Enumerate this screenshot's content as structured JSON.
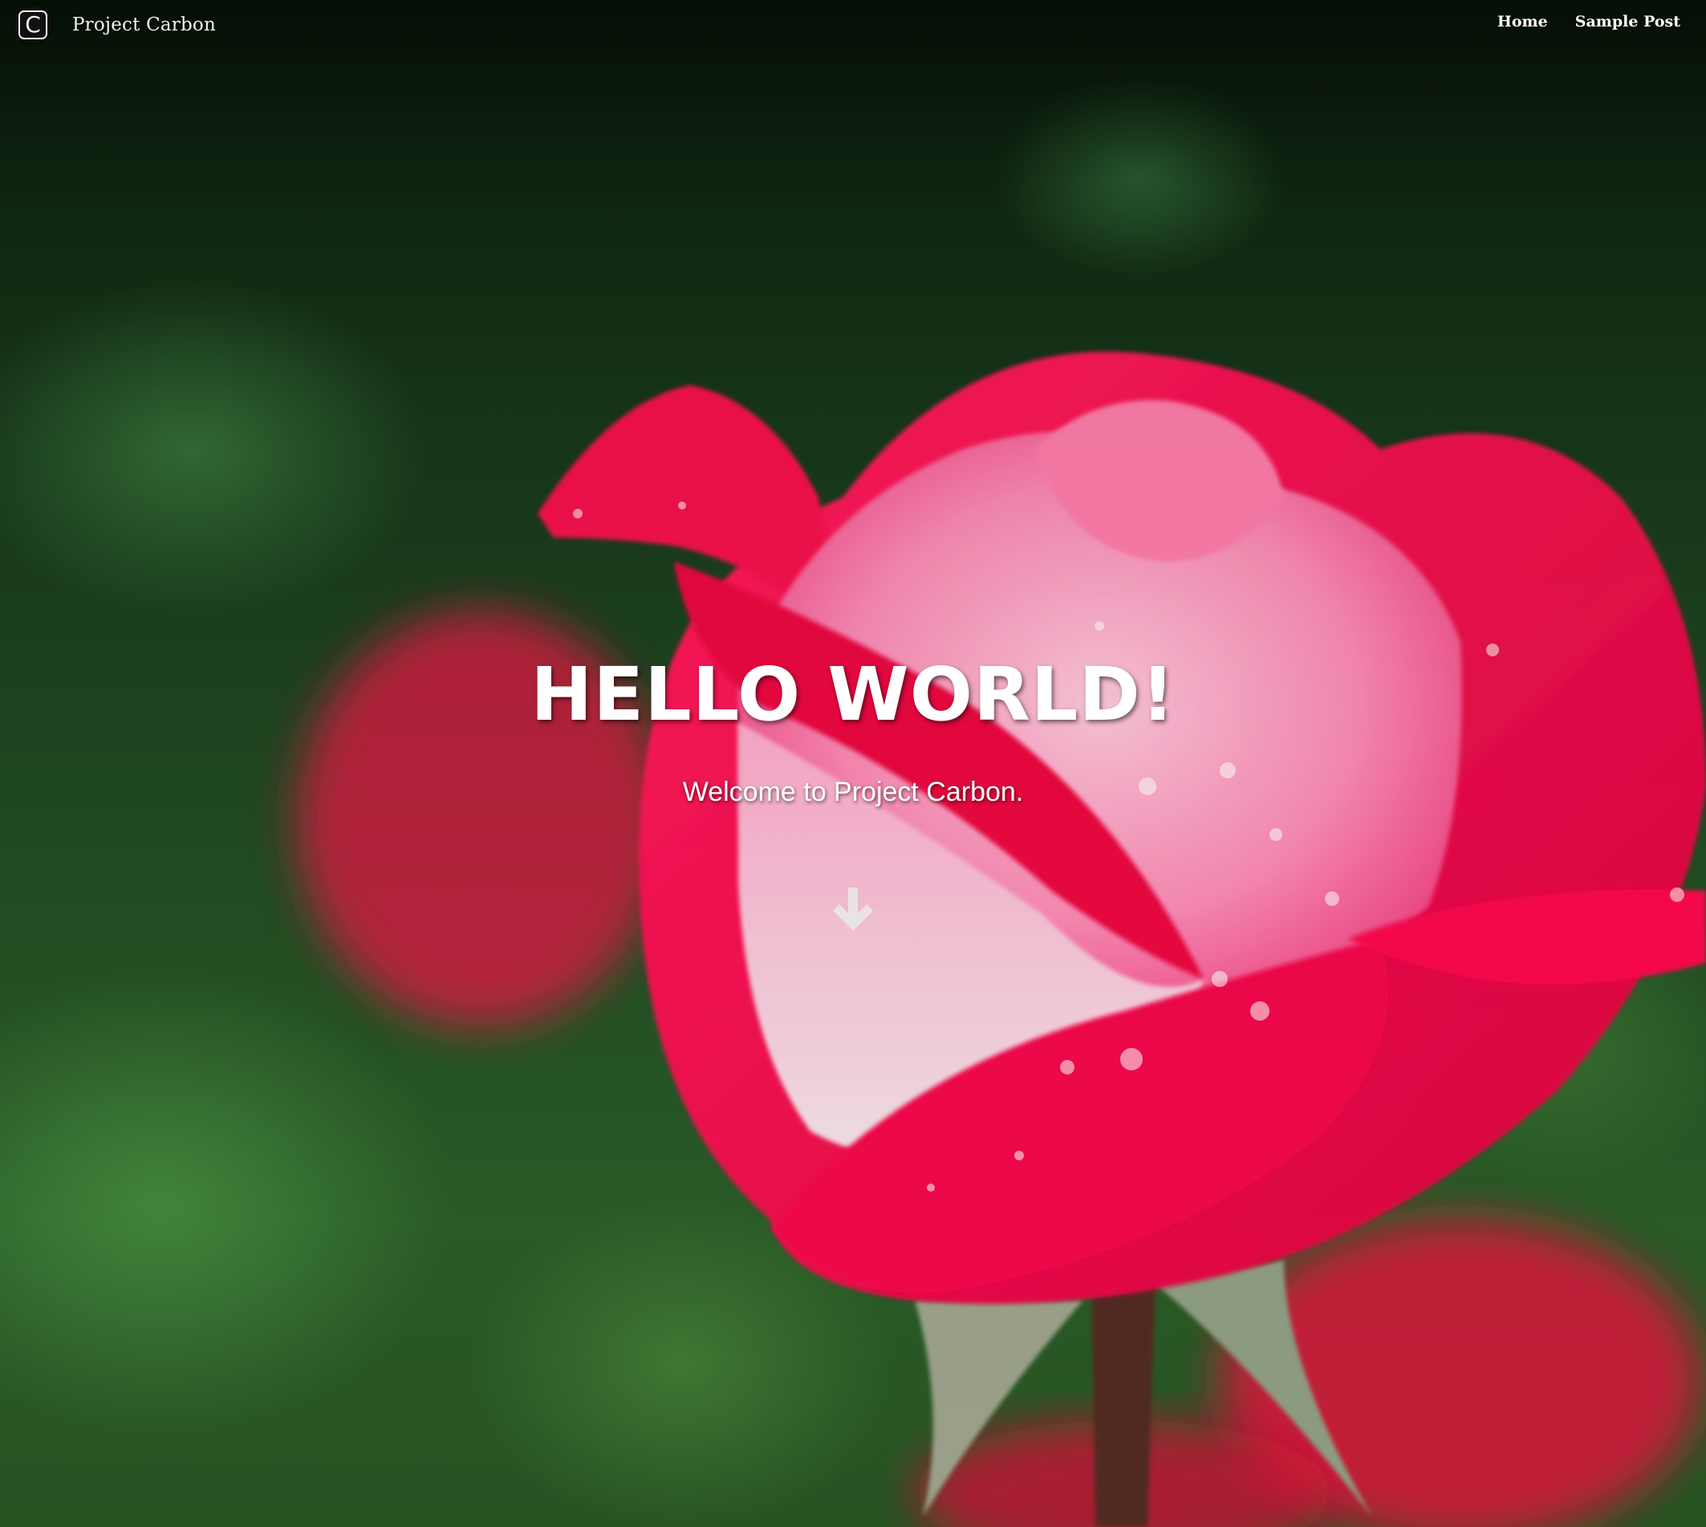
{
  "site": {
    "name": "Project Carbon",
    "logo_letter": "C"
  },
  "nav": {
    "items": [
      {
        "label": "Home"
      },
      {
        "label": "Sample Post"
      }
    ]
  },
  "hero": {
    "title": "HELLO WORLD!",
    "subtitle": "Welcome to Project Carbon.",
    "scroll_icon": "arrow-down-icon"
  },
  "colors": {
    "nav_text": "#ffffff",
    "title_text": "#ffffff",
    "background_green": "#244a24",
    "rose_red": "#e0144a",
    "rose_pink": "#f3a0bf"
  }
}
